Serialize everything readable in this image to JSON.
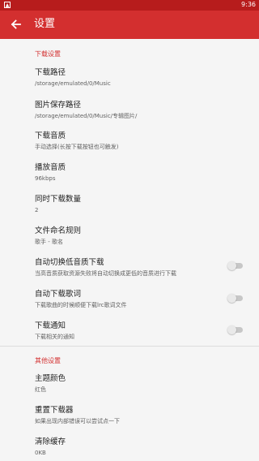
{
  "status_bar": {
    "time": "9:36",
    "app_icon": "notification-icon"
  },
  "toolbar": {
    "title": "设置",
    "back_icon": "back-arrow-icon"
  },
  "download_section": {
    "header": "下载设置",
    "items": [
      {
        "title": "下载路径",
        "subtitle": "/storage/emulated/0/Music"
      },
      {
        "title": "图片保存路径",
        "subtitle": "/storage/emulated/0/Music/专辑图片/"
      },
      {
        "title": "下载音质",
        "subtitle": "手动选择(长按下载按钮也可触发)"
      },
      {
        "title": "播放音质",
        "subtitle": "96kbps"
      },
      {
        "title": "同时下载数量",
        "subtitle": "2"
      },
      {
        "title": "文件命名规则",
        "subtitle": "歌手 - 歌名"
      },
      {
        "title": "自动切换低音质下载",
        "subtitle": "当高音质获取资源失败将自动切换成更低的音质进行下载",
        "toggle": false
      },
      {
        "title": "自动下载歌词",
        "subtitle": "下载歌曲的时候顺便下载lrc歌词文件",
        "toggle": false
      },
      {
        "title": "下载通知",
        "subtitle": "下载相关的通知",
        "toggle": false
      }
    ]
  },
  "other_section": {
    "header": "其他设置",
    "items": [
      {
        "title": "主题颜色",
        "subtitle": "红色"
      },
      {
        "title": "重置下载器",
        "subtitle": "如果出现内部错误可以尝试点一下"
      },
      {
        "title": "清除缓存",
        "subtitle": "0KB"
      }
    ]
  },
  "colors": {
    "accent": "#d32f2f",
    "status_bar": "#b71c1c",
    "background": "#f5f5f5"
  }
}
